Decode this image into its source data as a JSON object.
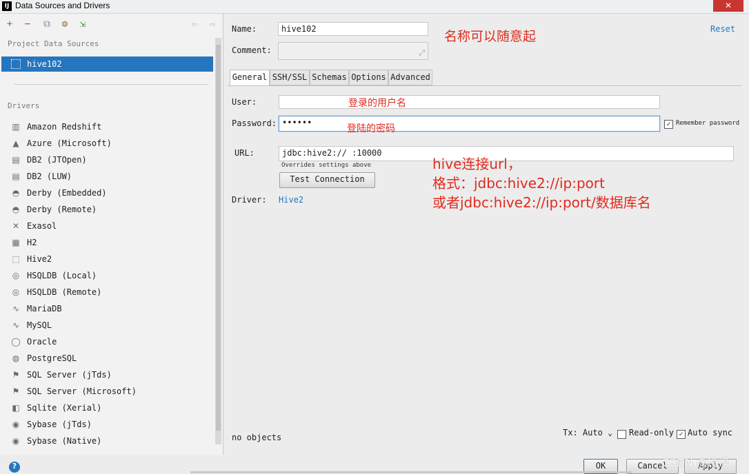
{
  "window": {
    "title": "Data Sources and Drivers",
    "app_icon": "IJ",
    "close": "✕"
  },
  "left": {
    "project_header": "Project Data Sources",
    "selected": "hive102",
    "drivers_header": "Drivers",
    "drivers": [
      {
        "label": "Amazon Redshift",
        "icon": "redshift-icon",
        "glyph": "▥"
      },
      {
        "label": "Azure (Microsoft)",
        "icon": "azure-icon",
        "glyph": "▲"
      },
      {
        "label": "DB2 (JTOpen)",
        "icon": "db2-icon",
        "glyph": "▤"
      },
      {
        "label": "DB2 (LUW)",
        "icon": "db2-icon",
        "glyph": "▤"
      },
      {
        "label": "Derby (Embedded)",
        "icon": "derby-icon",
        "glyph": "◓"
      },
      {
        "label": "Derby (Remote)",
        "icon": "derby-icon",
        "glyph": "◓"
      },
      {
        "label": "Exasol",
        "icon": "exasol-icon",
        "glyph": "✕"
      },
      {
        "label": "H2",
        "icon": "h2-icon",
        "glyph": "▦"
      },
      {
        "label": "Hive2",
        "icon": "hive-icon",
        "glyph": "⬚"
      },
      {
        "label": "HSQLDB (Local)",
        "icon": "hsqldb-icon",
        "glyph": "◎"
      },
      {
        "label": "HSQLDB (Remote)",
        "icon": "hsqldb-icon",
        "glyph": "◎"
      },
      {
        "label": "MariaDB",
        "icon": "mariadb-icon",
        "glyph": "∿"
      },
      {
        "label": "MySQL",
        "icon": "mysql-icon",
        "glyph": "∿"
      },
      {
        "label": "Oracle",
        "icon": "oracle-icon",
        "glyph": "◯"
      },
      {
        "label": "PostgreSQL",
        "icon": "postgresql-icon",
        "glyph": "◍"
      },
      {
        "label": "SQL Server (jTds)",
        "icon": "sqlserver-icon",
        "glyph": "⚑"
      },
      {
        "label": "SQL Server (Microsoft)",
        "icon": "sqlserver-icon",
        "glyph": "⚑"
      },
      {
        "label": "Sqlite (Xerial)",
        "icon": "sqlite-icon",
        "glyph": "◧"
      },
      {
        "label": "Sybase (jTds)",
        "icon": "sybase-icon",
        "glyph": "◉"
      },
      {
        "label": "Sybase (Native)",
        "icon": "sybase-icon",
        "glyph": "◉"
      }
    ]
  },
  "form": {
    "name_label": "Name:",
    "name_value": "hive102",
    "comment_label": "Comment:",
    "reset": "Reset",
    "tabs": [
      "General",
      "SSH/SSL",
      "Schemas",
      "Options",
      "Advanced"
    ],
    "user_label": "User:",
    "password_label": "Password:",
    "password_value": "••••••",
    "remember_password": "Remember password",
    "url_label": "URL:",
    "url_value": "jdbc:hive2://          :10000",
    "url_hint": "Overrides settings above",
    "test_connection": "Test Connection",
    "driver_label": "Driver:",
    "driver_value": "Hive2",
    "no_objects": "no objects",
    "tx_label": "Tx: Auto",
    "read_only": "Read-only",
    "auto_sync": "Auto sync",
    "ok": "OK",
    "cancel": "Cancel",
    "apply": "Apply"
  },
  "annotations": {
    "name_note": "名称可以随意起",
    "user_note": "登录的用户名",
    "password_note": "登陆的密码",
    "url_note_1": "hive连接url，",
    "url_note_2": "格式：jdbc:hive2://ip:port",
    "url_note_3": "或者jdbc:hive2://ip:port/数据库名"
  },
  "watermark": "CSDN @冷漠；",
  "colors": {
    "selection": "#2675bf",
    "annotation_red": "#e02a1e",
    "link": "#2675bf"
  }
}
